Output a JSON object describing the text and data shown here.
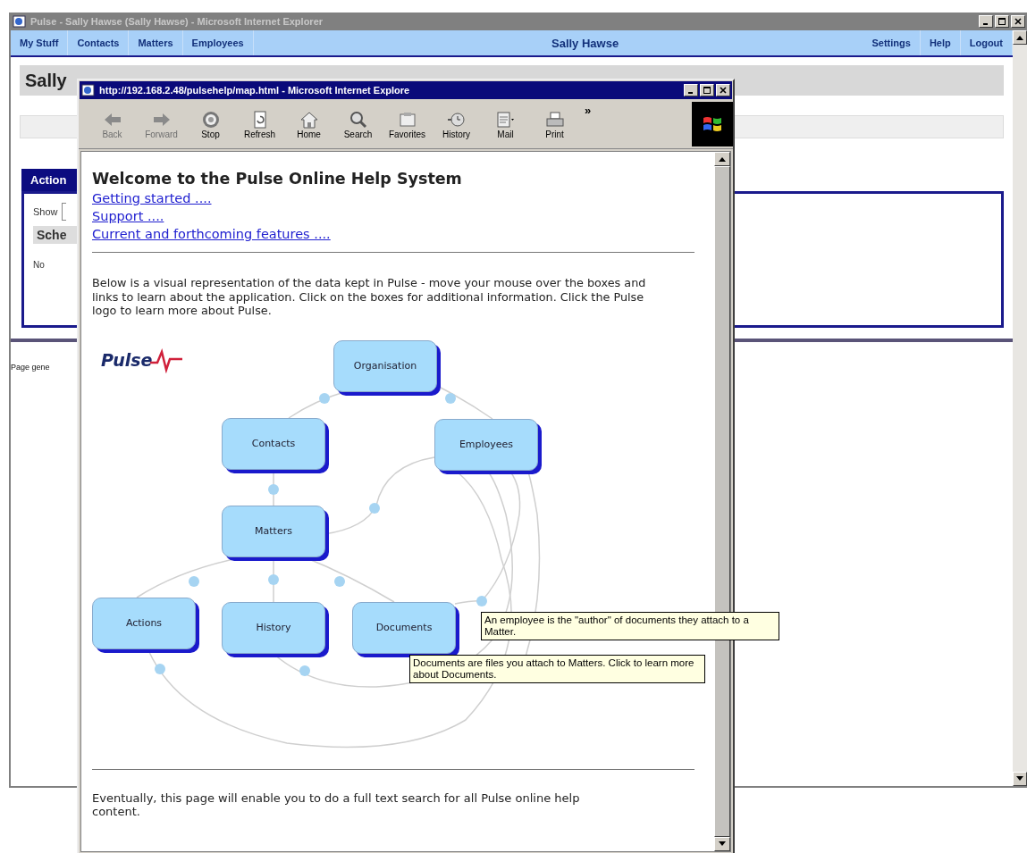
{
  "main_window": {
    "title": "Pulse - Sally Hawse (Sally Hawse) - Microsoft Internet Explorer",
    "nav": [
      {
        "label": "My Stuff"
      },
      {
        "label": "Contacts"
      },
      {
        "label": "Matters"
      },
      {
        "label": "Employees"
      }
    ],
    "user_name": "Sally Hawse",
    "nav_right": [
      {
        "label": "Settings"
      },
      {
        "label": "Help"
      },
      {
        "label": "Logout"
      }
    ],
    "page_heading": "Sally",
    "actions_panel": {
      "title": "Action",
      "show_label": "Show",
      "column_header": "Sche",
      "empty_text": "No"
    },
    "footer": "Page gene"
  },
  "help_window": {
    "title": "http://192.168.2.48/pulsehelp/map.html - Microsoft Internet Explore",
    "toolbar": [
      {
        "kind": "back",
        "label": "Back",
        "disabled": true
      },
      {
        "kind": "forward",
        "label": "Forward",
        "disabled": true
      },
      {
        "kind": "stop",
        "label": "Stop",
        "disabled": false
      },
      {
        "kind": "refresh",
        "label": "Refresh",
        "disabled": false
      },
      {
        "kind": "home",
        "label": "Home",
        "disabled": false
      },
      {
        "kind": "search",
        "label": "Search",
        "disabled": false
      },
      {
        "kind": "favorites",
        "label": "Favorites",
        "disabled": false
      },
      {
        "kind": "history",
        "label": "History",
        "disabled": false
      },
      {
        "kind": "mail",
        "label": "Mail",
        "disabled": false
      },
      {
        "kind": "print",
        "label": "Print",
        "disabled": false
      }
    ],
    "toolbar_overflow": "»",
    "heading": "Welcome to the Pulse Online Help System",
    "links": [
      "Getting started ....",
      "Support ....",
      "Current and forthcoming features ...."
    ],
    "intro": "Below is a visual representation of the data kept in Pulse - move your mouse over the boxes and links to learn about the application. Click on the boxes for additional information. Click the Pulse logo to learn more about Pulse.",
    "logo": "Pulse",
    "diagram": {
      "nodes": [
        {
          "label": "Organisation"
        },
        {
          "label": "Contacts"
        },
        {
          "label": "Employees"
        },
        {
          "label": "Matters"
        },
        {
          "label": "Actions"
        },
        {
          "label": "History"
        },
        {
          "label": "Documents"
        }
      ]
    },
    "tooltips": [
      "An employee is the \"author\" of documents they attach to a Matter.",
      "Documents are files you attach to Matters.  Click to learn more about Documents."
    ],
    "footer_text": "Eventually, this page will enable you to do a full text search for all Pulse online help content."
  }
}
